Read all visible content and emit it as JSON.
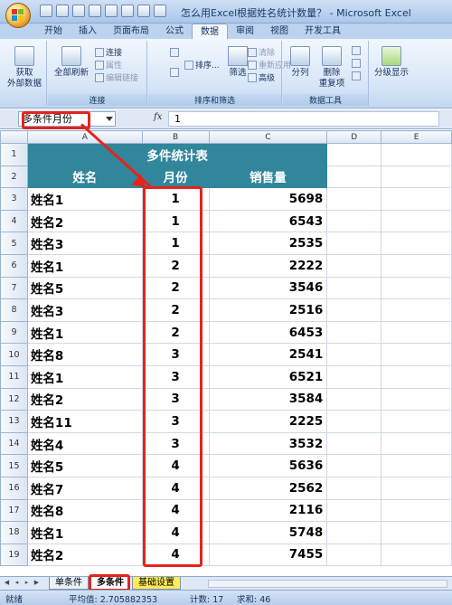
{
  "window": {
    "title": "怎么用Excel根据姓名统计数量？ - Microsoft Excel"
  },
  "ribbon": {
    "tabs": [
      "开始",
      "插入",
      "页面布局",
      "公式",
      "数据",
      "审阅",
      "视图",
      "开发工具"
    ],
    "active_tab": "数据",
    "groups": {
      "get_external": {
        "label_line1": "获取",
        "label_line2": "外部数据"
      },
      "connections": {
        "refresh": "全部刷新",
        "connect": "连接",
        "properties": "属性",
        "edit_links": "编辑链接",
        "group_label": "连接"
      },
      "sort_filter": {
        "sort": "排序...",
        "filter": "筛选",
        "clear": "清除",
        "reapply": "重新应用",
        "advanced": "高级",
        "group_label": "排序和筛选"
      },
      "data_tools": {
        "split": "分列",
        "remove_dup_1": "删除",
        "remove_dup_2": "重复项",
        "group_label": "数据工具"
      },
      "outline": {
        "label": "分级显示"
      }
    }
  },
  "formula_bar": {
    "name_box": "多条件月份",
    "fx": "fx",
    "value": "1"
  },
  "grid": {
    "columns": [
      "A",
      "B",
      "C",
      "D",
      "E"
    ],
    "table_title": "多件统计表",
    "headers": {
      "name": "姓名",
      "month": "月份",
      "sales": "销售量"
    },
    "rows": [
      {
        "r": "3",
        "name": "姓名1",
        "month": "1",
        "sales": "5698"
      },
      {
        "r": "4",
        "name": "姓名2",
        "month": "1",
        "sales": "6543"
      },
      {
        "r": "5",
        "name": "姓名3",
        "month": "1",
        "sales": "2535"
      },
      {
        "r": "6",
        "name": "姓名1",
        "month": "2",
        "sales": "2222"
      },
      {
        "r": "7",
        "name": "姓名5",
        "month": "2",
        "sales": "3546"
      },
      {
        "r": "8",
        "name": "姓名3",
        "month": "2",
        "sales": "2516"
      },
      {
        "r": "9",
        "name": "姓名1",
        "month": "2",
        "sales": "6453"
      },
      {
        "r": "10",
        "name": "姓名8",
        "month": "3",
        "sales": "2541"
      },
      {
        "r": "11",
        "name": "姓名1",
        "month": "3",
        "sales": "6521"
      },
      {
        "r": "12",
        "name": "姓名2",
        "month": "3",
        "sales": "3584"
      },
      {
        "r": "13",
        "name": "姓名11",
        "month": "3",
        "sales": "2225"
      },
      {
        "r": "14",
        "name": "姓名4",
        "month": "3",
        "sales": "3532"
      },
      {
        "r": "15",
        "name": "姓名5",
        "month": "4",
        "sales": "5636"
      },
      {
        "r": "16",
        "name": "姓名7",
        "month": "4",
        "sales": "2562"
      },
      {
        "r": "17",
        "name": "姓名8",
        "month": "4",
        "sales": "2116"
      },
      {
        "r": "18",
        "name": "姓名1",
        "month": "4",
        "sales": "5748"
      },
      {
        "r": "19",
        "name": "姓名2",
        "month": "4",
        "sales": "7455"
      }
    ]
  },
  "sheets": {
    "tab1": "单条件",
    "tab2": "多条件",
    "tab3": "基础设置"
  },
  "status": {
    "ready": "就绪",
    "average": "平均值: 2.705882353",
    "count": "计数: 17",
    "sum": "求和: 46"
  },
  "colors": {
    "header_fill": "#31869b",
    "highlight": "#e5231c",
    "ribbon_blue": "#bcd3ef"
  }
}
